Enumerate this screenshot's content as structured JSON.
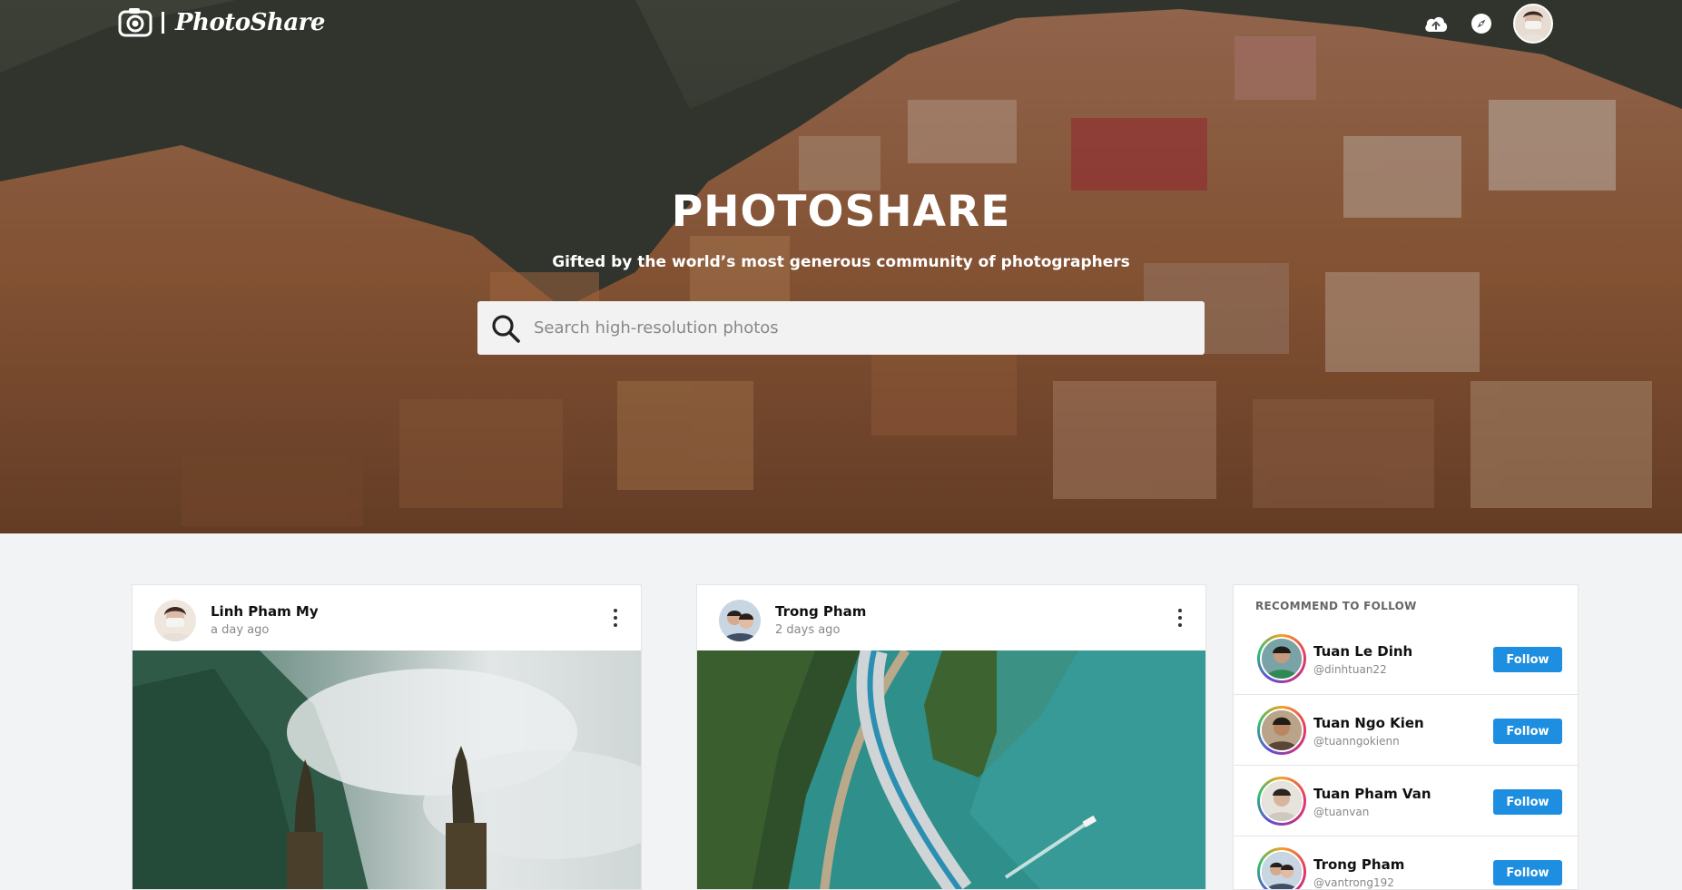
{
  "header": {
    "brand": "PhotoShare",
    "icons": [
      "cloud-upload-icon",
      "compass-icon"
    ]
  },
  "hero": {
    "title": "PHOTOSHARE",
    "subtitle": "Gifted by the world’s most generous community of photographers",
    "search_placeholder": "Search high-resolution photos"
  },
  "posts": [
    {
      "author": "Linh Pham My",
      "time": "a day ago"
    },
    {
      "author": "Trong Pham",
      "time": "2 days ago"
    }
  ],
  "recommend": {
    "title": "RECOMMEND TO FOLLOW",
    "users": [
      {
        "name": "Tuan Le Dinh",
        "handle": "@dinhtuan22",
        "button": "Follow"
      },
      {
        "name": "Tuan Ngo Kien",
        "handle": "@tuanngokienn",
        "button": "Follow"
      },
      {
        "name": "Tuan Pham Van",
        "handle": "@tuanvan",
        "button": "Follow"
      },
      {
        "name": "Trong Pham",
        "handle": "@vantrong192",
        "button": "Follow"
      }
    ]
  },
  "colors": {
    "accent": "#1e8fe0",
    "page_bg": "#f1f3f4",
    "card_bg": "#ffffff"
  }
}
